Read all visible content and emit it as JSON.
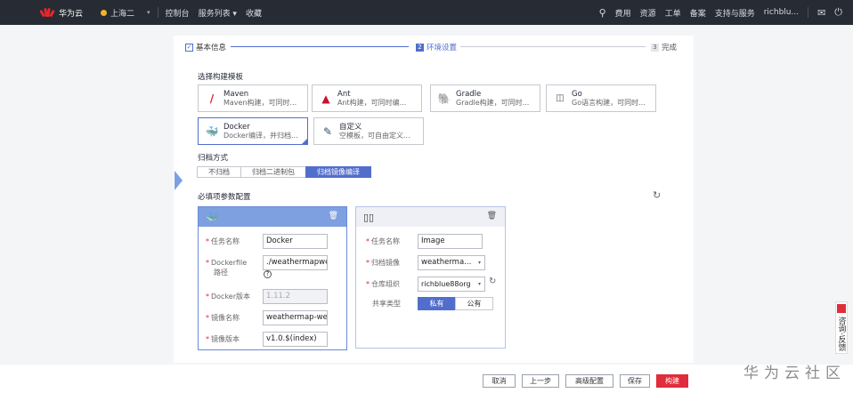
{
  "topbar": {
    "brand": "华为云",
    "region": "上海二",
    "links": [
      "控制台",
      "服务列表 ▾",
      "收藏"
    ],
    "right": [
      "费用",
      "资源",
      "工单",
      "备案",
      "支持与服务",
      "richblu..."
    ],
    "icons": [
      "search-icon",
      "mail-icon",
      "power-icon"
    ]
  },
  "steps": [
    {
      "label": "基本信息",
      "state": "done"
    },
    {
      "num": "2",
      "label": "环境设置",
      "state": "active"
    },
    {
      "num": "3",
      "label": "完成",
      "state": "todo"
    }
  ],
  "template_section": {
    "title": "选择构建模板",
    "items": [
      {
        "name": "Maven",
        "desc": "Maven构建，可同时...",
        "icon": "maven-icon"
      },
      {
        "name": "Ant",
        "desc": "Ant构建，可同时编...",
        "icon": "ant-icon"
      },
      {
        "name": "Gradle",
        "desc": "Gradle构建，可同时...",
        "icon": "gradle-icon"
      },
      {
        "name": "Go",
        "desc": "Go语言构建，可同时...",
        "icon": "go-icon"
      },
      {
        "name": "Docker",
        "desc": "Docker编译，并归档...",
        "icon": "docker-icon"
      },
      {
        "name": "自定义",
        "desc": "空模板，可自由定义...",
        "icon": "custom-icon"
      }
    ],
    "selected": "Docker"
  },
  "archive": {
    "title": "归档方式",
    "options": [
      "不归档",
      "归档二进制包",
      "归档镜像编译"
    ],
    "selected": "归档镜像编译"
  },
  "params": {
    "title": "必填项参数配置",
    "docker_card": {
      "fields": [
        {
          "label": "任务名称",
          "value": "Docker"
        },
        {
          "label": "Dockerfile",
          "label2": "路径",
          "value": "./weathermapwe",
          "help": "?"
        },
        {
          "label": "Docker版本",
          "value": "1.11.2",
          "disabled": true
        },
        {
          "label": "镜像名称",
          "value": "weathermap-wea"
        },
        {
          "label": "镜像版本",
          "value": "v1.0.$(index)"
        }
      ]
    },
    "image_card": {
      "fields": [
        {
          "label": "任务名称",
          "value": "Image"
        },
        {
          "label": "归档镜像",
          "value": "weatherma...",
          "dropdown": true
        },
        {
          "label": "仓库组织",
          "value": "richblue88org",
          "dropdown": true
        }
      ],
      "share_label": "共享类型",
      "share_options": [
        "私有",
        "公有"
      ],
      "share_selected": "私有"
    }
  },
  "footer_buttons": [
    "取消",
    "上一步",
    "高级配置",
    "保存",
    "构建"
  ],
  "watermark": "华为云社区",
  "side_tab": "咨询·反馈"
}
